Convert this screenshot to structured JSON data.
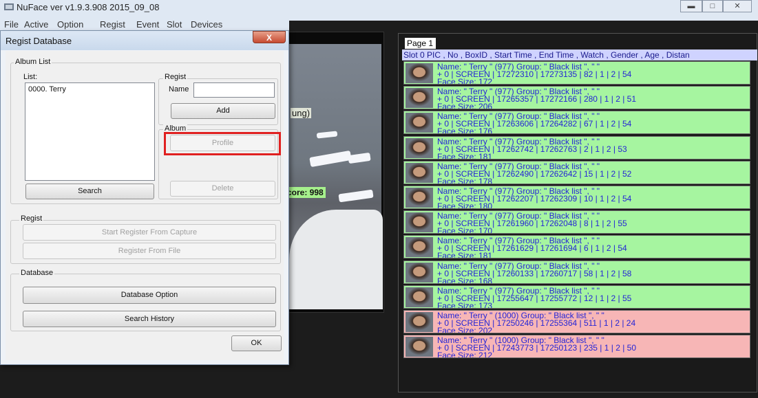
{
  "window": {
    "title": "NuFace ver v1.9.3.908 2015_09_08"
  },
  "menu": [
    "File",
    "Active",
    "Option",
    "Regist",
    "Event",
    "Slot",
    "Devices"
  ],
  "video": {
    "face_text": "ung)",
    "score_text": "core: 998"
  },
  "right_panel": {
    "page_label": "Page 1",
    "header": "Slot 0 PIC , No , BoxID , Start Time , End Time , Watch , Gender , Age , Distan",
    "rows": [
      {
        "l1": "Name: \" Terry \" (977)          Group: \" Black list \", \"  \"",
        "l2": "+ 0 | SCREEN | 17272310 | 17273135 |  82 | 1 |  2 | 54",
        "l3": "Face Size: 172",
        "color": "#a6f5a0"
      },
      {
        "l1": "Name: \" Terry \" (977)          Group: \" Black list \", \"  \"",
        "l2": "+ 0 | SCREEN | 17265357 | 17272166 | 280 | 1 |  2 | 51",
        "l3": "Face Size: 206",
        "color": "#a6f5a0"
      },
      {
        "l1": "Name: \" Terry \" (977)          Group: \" Black list \", \"  \"",
        "l2": "+ 0 | SCREEN | 17263606 | 17264282 |  67 | 1 |  2 | 54",
        "l3": "Face Size: 176",
        "color": "#a6f5a0"
      },
      {
        "l1": "Name: \" Terry \" (977)          Group: \" Black list \", \"  \"",
        "l2": "+ 0 | SCREEN | 17262742 | 17262763 |   2 | 1 |  2 | 53",
        "l3": "Face Size: 181",
        "color": "#a6f5a0"
      },
      {
        "l1": "Name: \" Terry \" (977)          Group: \" Black list \", \"  \"",
        "l2": "+ 0 | SCREEN | 17262490 | 17262642 |  15 | 1 |  2 | 52",
        "l3": "Face Size: 178",
        "color": "#a6f5a0"
      },
      {
        "l1": "Name: \" Terry \" (977)          Group: \" Black list \", \"  \"",
        "l2": "+ 0 | SCREEN | 17262207 | 17262309 |  10 | 1 |  2 | 54",
        "l3": "Face Size: 180",
        "color": "#a6f5a0"
      },
      {
        "l1": "Name: \" Terry \" (977)          Group: \" Black list \", \"  \"",
        "l2": "+ 0 | SCREEN | 17261960 | 17262048 |   8 | 1 |  2 | 55",
        "l3": "Face Size: 170",
        "color": "#a6f5a0"
      },
      {
        "l1": "Name: \" Terry \" (977)          Group: \" Black list \", \"  \"",
        "l2": "+ 0 | SCREEN | 17261629 | 17261694 |   6 | 1 |  2 | 54",
        "l3": "Face Size: 181",
        "color": "#a6f5a0"
      },
      {
        "l1": "Name: \" Terry \" (977)          Group: \" Black list \", \"  \"",
        "l2": "+ 0 | SCREEN | 17260133 | 17260717 |  58 | 1 |  2 | 58",
        "l3": "Face Size: 168",
        "color": "#a6f5a0"
      },
      {
        "l1": "Name: \" Terry \" (977)          Group: \" Black list \", \"  \"",
        "l2": "+ 0 | SCREEN | 17255647 | 17255772 |  12 | 1 |  2 | 55",
        "l3": "Face Size: 173",
        "color": "#a6f5a0"
      },
      {
        "l1": "Name: \" Terry \" (1000)          Group: \" Black list \", \"  \"",
        "l2": "+ 0 | SCREEN | 17250246 | 17255364 | 511 | 1 |  2 | 24",
        "l3": "Face Size: 202",
        "color": "#f7b6b6"
      },
      {
        "l1": "Name: \" Terry \" (1000)          Group: \" Black list \", \"  \"",
        "l2": "+ 0 | SCREEN | 17243773 | 17250123 | 235 | 1 |  2 | 50",
        "l3": "Face Size: 212",
        "color": "#f7b6b6"
      }
    ]
  },
  "dialog": {
    "title": "Regist Database",
    "close_glyph": "X",
    "album_list": {
      "legend": "Album List",
      "list_label": "List:",
      "items": [
        "0000. Terry"
      ],
      "search_label": "Search"
    },
    "regist_group": {
      "legend": "Regist",
      "name_label": "Name",
      "name_value": "",
      "add_label": "Add"
    },
    "album_group": {
      "legend": "Album",
      "profile_label": "Profile",
      "delete_label": "Delete"
    },
    "regist_section": {
      "legend": "Regist",
      "start_capture_label": "Start Register From Capture",
      "from_file_label": "Register From File"
    },
    "database_section": {
      "legend": "Database",
      "option_label": "Database Option",
      "history_label": "Search History"
    },
    "ok_label": "OK"
  }
}
